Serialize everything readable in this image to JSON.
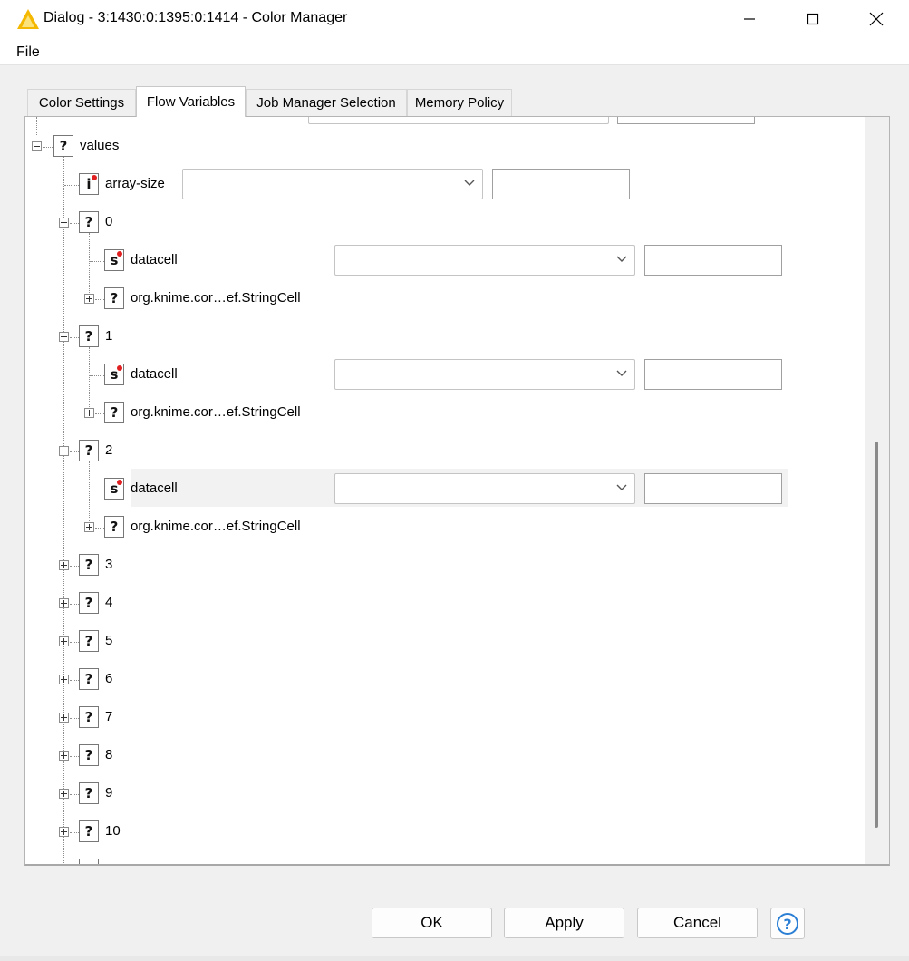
{
  "window": {
    "title": "Dialog - 3:1430:0:1395:0:1414 - Color Manager",
    "accent": "#f5b800"
  },
  "menu": {
    "file": "File"
  },
  "tabs": [
    {
      "label": "Color Settings",
      "active": false
    },
    {
      "label": "Flow Variables",
      "active": true
    },
    {
      "label": "Job Manager Selection",
      "active": false
    },
    {
      "label": "Memory Policy",
      "active": false
    }
  ],
  "tree": {
    "root": {
      "icon": "?",
      "label": "values"
    },
    "array_size": {
      "icon": "i",
      "label": "array-size",
      "variable": "",
      "value": ""
    },
    "items": [
      {
        "index": "0",
        "expanded": true,
        "children": [
          {
            "icon": "s",
            "label": "datacell",
            "variable": "",
            "value": ""
          },
          {
            "icon": "?",
            "label": "org.knime.cor…ef.StringCell"
          }
        ]
      },
      {
        "index": "1",
        "expanded": true,
        "children": [
          {
            "icon": "s",
            "label": "datacell",
            "variable": "",
            "value": ""
          },
          {
            "icon": "?",
            "label": "org.knime.cor…ef.StringCell"
          }
        ]
      },
      {
        "index": "2",
        "expanded": true,
        "children": [
          {
            "icon": "s",
            "label": "datacell",
            "variable": "",
            "value": ""
          },
          {
            "icon": "?",
            "label": "org.knime.cor…ef.StringCell"
          }
        ]
      },
      {
        "index": "3"
      },
      {
        "index": "4"
      },
      {
        "index": "5"
      },
      {
        "index": "6"
      },
      {
        "index": "7"
      },
      {
        "index": "8"
      },
      {
        "index": "9"
      },
      {
        "index": "10"
      }
    ]
  },
  "buttons": {
    "ok": "OK",
    "apply": "Apply",
    "cancel": "Cancel"
  },
  "icons": {
    "app": "knime-warning-triangle-icon",
    "help": "help-question-icon",
    "minimize": "minimize-icon",
    "maximize": "maximize-icon",
    "close": "close-icon"
  }
}
